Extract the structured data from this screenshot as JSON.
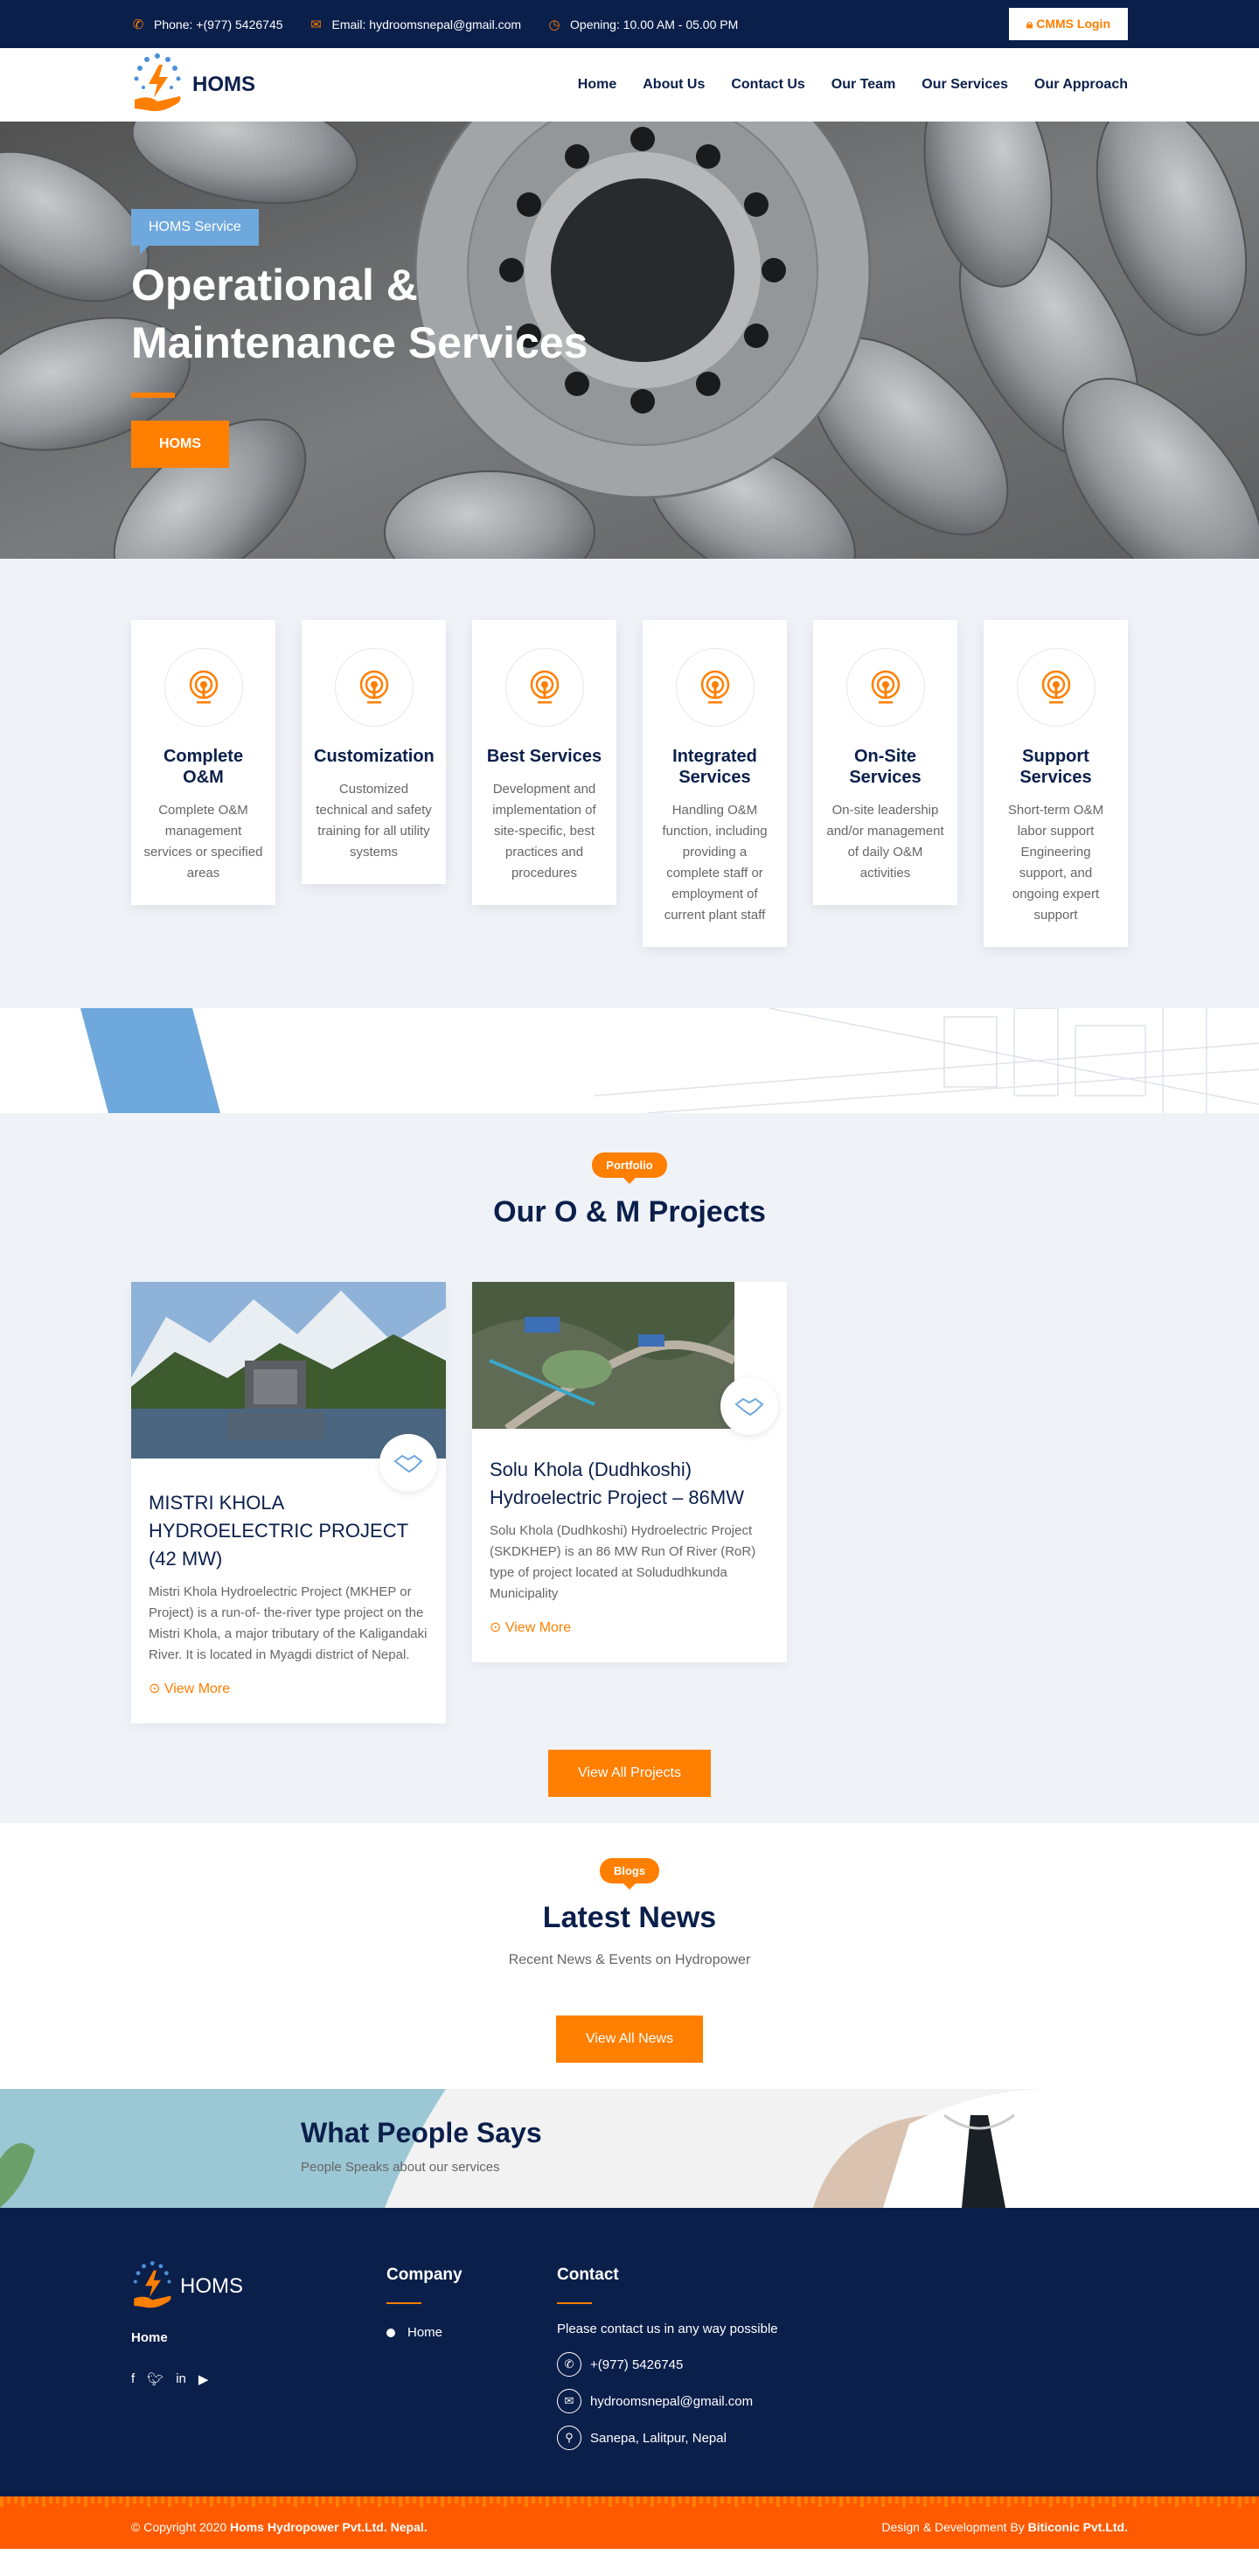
{
  "topbar": {
    "phone": "Phone: +(977) 5426745",
    "email": "Email: hydroomsnepal@gmail.com",
    "opening": "Opening: 10.00 AM - 05.00 PM",
    "cmms_label": "CMMS Login"
  },
  "header": {
    "logo_text": "HOMS",
    "nav": [
      "Home",
      "About Us",
      "Contact Us",
      "Our Team",
      "Our Services",
      "Our Approach"
    ]
  },
  "hero": {
    "tag": "HOMS Service",
    "title": "Operational & Maintenance Services",
    "button": "HOMS"
  },
  "services": [
    {
      "title": "Complete O&M",
      "text": "Complete O&M management services or specified areas"
    },
    {
      "title": "Customization",
      "text": "Customized technical and safety training for all utility systems"
    },
    {
      "title": "Best Services",
      "text": "Development and implementation of site-specific, best practices and procedures"
    },
    {
      "title": "Integrated Services",
      "text": "Handling O&M function, including providing a complete staff or employment of current plant staff"
    },
    {
      "title": "On-Site Services",
      "text": "On-site leadership and/or management of daily O&M activities"
    },
    {
      "title": "Support Services",
      "text": "Short-term O&M labor support Engineering support, and ongoing expert support"
    }
  ],
  "projects": {
    "pill": "Portfolio",
    "title": "Our O & M Projects",
    "items": [
      {
        "title": "MISTRI KHOLA HYDROELECTRIC PROJECT (42 MW)",
        "text": "Mistri Khola Hydroelectric Project (MKHEP or Project) is a run-of- the-river type project on the Mistri Khola, a major tributary of the Kaligandaki River. It is located in Myagdi district of Nepal.",
        "link": "View More"
      },
      {
        "title": "Solu Khola (Dudhkoshi) Hydroelectric Project – 86MW",
        "text": "Solu Khola (Dudhkoshi) Hydroelectric Project (SKDKHEP) is an 86 MW Run Of River (RoR) type of project located at Solududhkunda Municipality",
        "link": "View More"
      }
    ],
    "button": "View All Projects"
  },
  "news": {
    "pill": "Blogs",
    "title": "Latest News",
    "subtitle": "Recent News & Events on Hydropower",
    "button": "View All News"
  },
  "testimonials": {
    "title": "What People Says",
    "subtitle": "People Speaks about our services"
  },
  "footer": {
    "logo_text": "HOMS",
    "home": "Home",
    "company_title": "Company",
    "company_links": [
      "Home"
    ],
    "contact_title": "Contact",
    "contact_intro": "Please contact us in any way possible",
    "phone": "+(977) 5426745",
    "email": "hydroomsnepal@gmail.com",
    "address": "Sanepa, Lalitpur, Nepal"
  },
  "copyright": {
    "prefix": "© Copyright 2020",
    "company": "Homs Hydropower Pvt.Ltd. Nepal.",
    "credit_prefix": "Design & Development By",
    "credit": "Biticonic Pvt.Ltd."
  },
  "colors": {
    "navy": "#0b1f4b",
    "orange": "#ff7f00",
    "blue": "#6fa8dc"
  }
}
